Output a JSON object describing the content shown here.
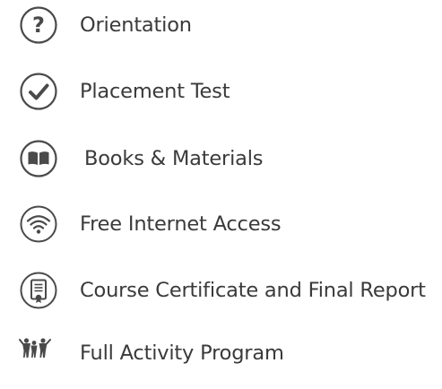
{
  "features": {
    "items": [
      {
        "label": "Orientation",
        "icon": "question-icon"
      },
      {
        "label": "Placement Test",
        "icon": "checkmark-icon"
      },
      {
        "label": "Books & Materials",
        "icon": "book-icon"
      },
      {
        "label": "Free Internet Access",
        "icon": "wifi-icon"
      },
      {
        "label": "Course Certificate and Final Report",
        "icon": "certificate-icon"
      },
      {
        "label": "Full Activity Program",
        "icon": "group-activity-icon"
      }
    ],
    "colors": {
      "text": "#3a3a3a",
      "icon": "#4a4a4a"
    }
  }
}
